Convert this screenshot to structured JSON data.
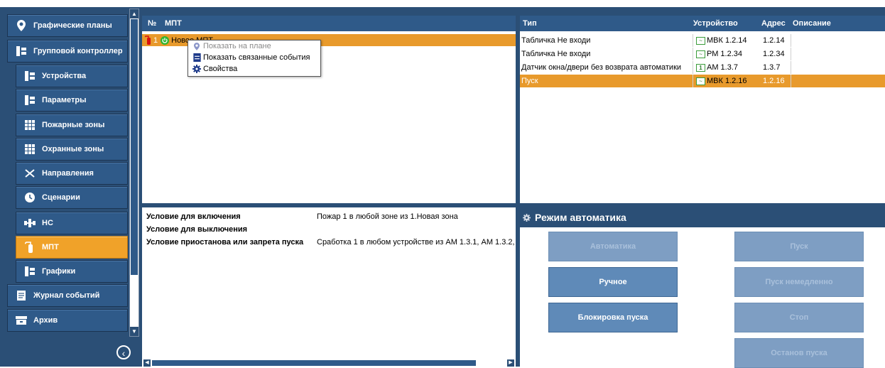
{
  "sidebar": {
    "items": [
      {
        "label": "Графические планы",
        "icon": "map-pin-icon",
        "level": "top"
      },
      {
        "label": "Групповой контроллер",
        "icon": "tree-icon",
        "level": "top"
      },
      {
        "label": "Устройства",
        "icon": "tree-icon",
        "level": "sub"
      },
      {
        "label": "Параметры",
        "icon": "tree-icon",
        "level": "sub"
      },
      {
        "label": "Пожарные зоны",
        "icon": "grid-icon",
        "level": "sub"
      },
      {
        "label": "Охранные зоны",
        "icon": "grid-icon",
        "level": "sub"
      },
      {
        "label": "Направления",
        "icon": "directions-icon",
        "level": "sub"
      },
      {
        "label": "Сценарии",
        "icon": "clock-icon",
        "level": "sub"
      },
      {
        "label": "НС",
        "icon": "pump-icon",
        "level": "sub"
      },
      {
        "label": "МПТ",
        "icon": "extinguisher-icon",
        "level": "sub",
        "active": true
      },
      {
        "label": "Графики",
        "icon": "tree-icon",
        "level": "sub"
      },
      {
        "label": "Журнал событий",
        "icon": "journal-icon",
        "level": "top"
      },
      {
        "label": "Архив",
        "icon": "archive-icon",
        "level": "top"
      }
    ]
  },
  "mpt": {
    "col_no": "№",
    "col_name": "МПТ",
    "row": {
      "no": "1",
      "name": "Новое МПТ"
    }
  },
  "context_menu": {
    "items": [
      {
        "label": "Показать на плане",
        "icon": "map-pin-icon",
        "disabled": true
      },
      {
        "label": "Показать связанные события",
        "icon": "journal-icon",
        "disabled": false
      },
      {
        "label": "Свойства",
        "icon": "gear-icon",
        "disabled": false
      }
    ]
  },
  "devices": {
    "headers": {
      "type": "Тип",
      "device": "Устройство",
      "address": "Адрес",
      "description": "Описание"
    },
    "rows": [
      {
        "type": "Табличка Не входи",
        "device": "МВК 1.2.14",
        "address": "1.2.14",
        "description": "",
        "icon": "wave-icon"
      },
      {
        "type": "Табличка Не входи",
        "device": "РМ 1.2.34",
        "address": "1.2.34",
        "description": "",
        "icon": "wave-icon"
      },
      {
        "type": "Датчик окна/двери без возврата автоматики",
        "device": "АМ 1.3.7",
        "address": "1.3.7",
        "description": "",
        "icon": "one-icon"
      },
      {
        "type": "Пуск",
        "device": "МВК 1.2.16",
        "address": "1.2.16",
        "description": "",
        "icon": "wave-icon",
        "selected": true
      }
    ]
  },
  "conditions": {
    "rows": [
      {
        "label": "Условие для включения",
        "value": "Пожар 1 в любой зоне из 1.Новая зона"
      },
      {
        "label": "Условие для выключения",
        "value": ""
      },
      {
        "label": "Условие приостанова или запрета пуска",
        "value": "Сработка 1 в любом устройстве из АМ 1.3.1, АМ 1.3.2,"
      }
    ]
  },
  "mode": {
    "title": "Режим автоматика",
    "buttons": {
      "auto": "Автоматика",
      "manual": "Ручное",
      "block": "Блокировка пуска",
      "start": "Пуск",
      "start_now": "Пуск немедленно",
      "stop": "Стоп",
      "suspend": "Останов пуска"
    }
  },
  "colors": {
    "accent": "#f0a229",
    "panel": "#2f5a89",
    "frame": "#2b4f76"
  }
}
